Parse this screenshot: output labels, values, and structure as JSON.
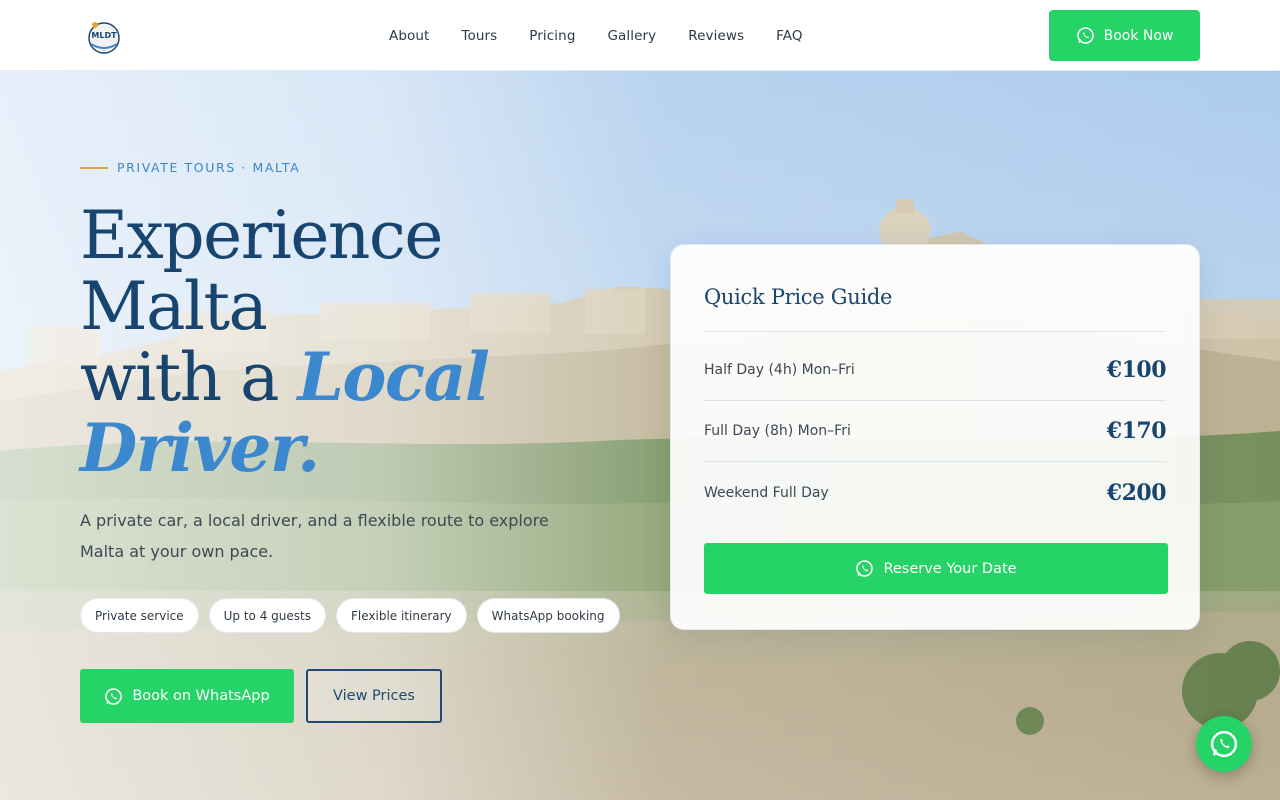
{
  "header": {
    "logo_text": "MLDT",
    "nav": [
      {
        "label": "About"
      },
      {
        "label": "Tours"
      },
      {
        "label": "Pricing"
      },
      {
        "label": "Gallery"
      },
      {
        "label": "Reviews"
      },
      {
        "label": "FAQ"
      }
    ],
    "book_now_label": "Book Now"
  },
  "hero": {
    "eyebrow": "PRIVATE TOURS · MALTA",
    "headline": {
      "line1": "Experience",
      "line2": "Malta",
      "line3_plain": "with a ",
      "line3_accent": "Local",
      "line4_accent": "Driver."
    },
    "subtitle": "A private car, a local driver, and a flexible route to explore Malta at your own pace.",
    "chips": [
      {
        "label": "Private service"
      },
      {
        "label": "Up to 4 guests"
      },
      {
        "label": "Flexible itinerary"
      },
      {
        "label": "WhatsApp booking"
      }
    ],
    "primary_cta": "Book on WhatsApp",
    "secondary_cta": "View Prices"
  },
  "price_card": {
    "title": "Quick Price Guide",
    "rows": [
      {
        "label": "Half Day (4h) Mon–Fri",
        "price": "€100"
      },
      {
        "label": "Full Day (8h) Mon–Fri",
        "price": "€170"
      },
      {
        "label": "Weekend Full Day",
        "price": "€200"
      }
    ],
    "reserve_label": "Reserve Your Date"
  },
  "colors": {
    "brand_green": "#25d366",
    "navy": "#17456f",
    "accent_blue": "#3b88cf",
    "gold": "#d9a441"
  },
  "icons": {
    "whatsapp": "whatsapp-icon"
  }
}
